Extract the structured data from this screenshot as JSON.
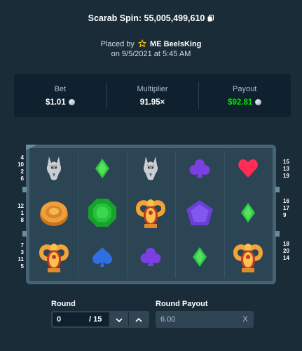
{
  "header": {
    "title": "Scarab Spin: 55,005,499,610",
    "placed_by_prefix": "Placed by",
    "username": "ME BeelsKing",
    "date_line": "on 9/5/2021 at 5:45 AM"
  },
  "stats": {
    "bet_label": "Bet",
    "bet_value": "$1.01",
    "multiplier_label": "Multiplier",
    "multiplier_value": "91.95×",
    "payout_label": "Payout",
    "payout_value": "$92.81"
  },
  "paylines": {
    "left": [
      [
        "4",
        "10",
        "2",
        "6"
      ],
      [
        "12",
        "1",
        "8"
      ],
      [
        "7",
        "3",
        "11",
        "5"
      ]
    ],
    "right": [
      [
        "15",
        "13",
        "19"
      ],
      [
        "16",
        "17",
        "9"
      ],
      [
        "18",
        "20",
        "14"
      ]
    ]
  },
  "reels": [
    [
      "wolf-icon",
      "diamond-icon",
      "wolf-icon",
      "club-icon",
      "heart-icon"
    ],
    [
      "coin-icon",
      "emerald-icon",
      "scarab-icon",
      "pentagon-gem-icon",
      "diamond-icon"
    ],
    [
      "scarab-icon",
      "spade-icon",
      "club-icon",
      "diamond-icon",
      "scarab-icon"
    ]
  ],
  "colors": {
    "background": "#1a2c38",
    "panel": "#0f212e",
    "green": "#00e701",
    "diamond": "#2ecc40",
    "club": "#7b3fe4",
    "heart": "#ff2d55",
    "spade": "#2f6fe4"
  },
  "controls": {
    "round_label": "Round",
    "round_value": "0",
    "round_total": "/ 15",
    "round_payout_label": "Round Payout",
    "round_payout_value": "6.00",
    "clear_label": "X"
  }
}
